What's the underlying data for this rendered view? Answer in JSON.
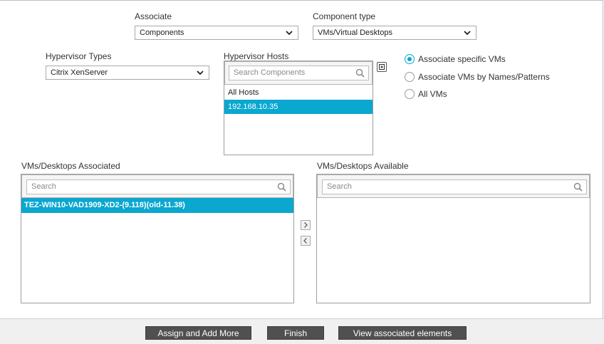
{
  "associate": {
    "label": "Associate",
    "value": "Components"
  },
  "component_type": {
    "label": "Component type",
    "value": "VMs/Virtual Desktops"
  },
  "hypervisor_types": {
    "label": "Hypervisor Types",
    "value": "Citrix XenServer"
  },
  "hypervisor_hosts": {
    "label": "Hypervisor Hosts",
    "search_placeholder": "Search Components",
    "items": [
      "All Hosts",
      "192.168.10.35"
    ],
    "selected_index": 1
  },
  "association_mode": {
    "options": [
      "Associate specific VMs",
      "Associate VMs by Names/Patterns",
      "All VMs"
    ],
    "selected_index": 0
  },
  "associated": {
    "label": "VMs/Desktops Associated",
    "search_placeholder": "Search",
    "items": [
      "TEZ-WIN10-VAD1909-XD2-(9.118)(old-11.38)"
    ]
  },
  "available": {
    "label": "VMs/Desktops Available",
    "search_placeholder": "Search",
    "items": []
  },
  "footer": {
    "assign_label": "Assign and Add More",
    "finish_label": "Finish",
    "view_label": "View associated elements"
  },
  "colors": {
    "accent": "#0aa7d0",
    "button": "#505050",
    "footer_bg": "#f0f0f0"
  },
  "icons": [
    "chevron-down-icon",
    "search-icon",
    "expand-icon",
    "chevron-right-icon",
    "chevron-left-icon"
  ]
}
